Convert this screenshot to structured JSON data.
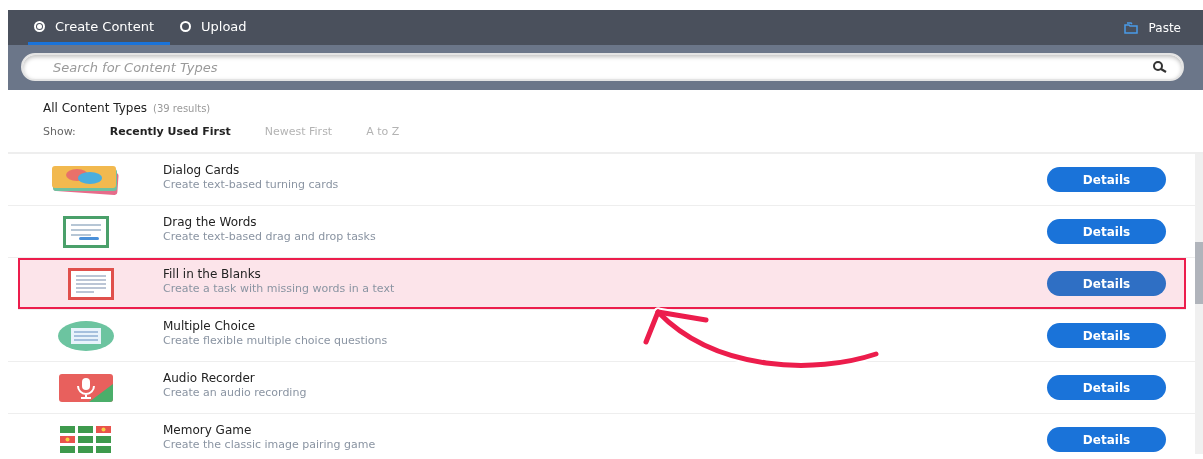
{
  "tabs": [
    {
      "label": "Create Content",
      "selected": true
    },
    {
      "label": "Upload",
      "selected": false
    }
  ],
  "paste_button": {
    "label": "Paste"
  },
  "search": {
    "placeholder": "Search for Content Types"
  },
  "heading": {
    "title": "All Content Types",
    "count": "(39 results)"
  },
  "sort": {
    "label": "Show:",
    "options": [
      {
        "label": "Recently Used First",
        "selected": true
      },
      {
        "label": "Newest First",
        "selected": false
      },
      {
        "label": "A to Z",
        "selected": false
      }
    ]
  },
  "content_types": [
    {
      "kind": "cards",
      "title": "Dialog Cards",
      "description": "Create text-based turning cards",
      "button": "Details",
      "selected": false
    },
    {
      "kind": "words",
      "title": "Drag the Words",
      "description": "Create text-based drag and drop tasks",
      "button": "Details",
      "selected": false
    },
    {
      "kind": "blanks",
      "title": "Fill in the Blanks",
      "description": "Create a task with missing words in a text",
      "button": "Details",
      "selected": true
    },
    {
      "kind": "choice",
      "title": "Multiple Choice",
      "description": "Create flexible multiple choice questions",
      "button": "Details",
      "selected": false
    },
    {
      "kind": "audio",
      "title": "Audio Recorder",
      "description": "Create an audio recording",
      "button": "Details",
      "selected": false
    },
    {
      "kind": "memory",
      "title": "Memory Game",
      "description": "Create the classic image pairing game",
      "button": "Details",
      "selected": false
    }
  ]
}
